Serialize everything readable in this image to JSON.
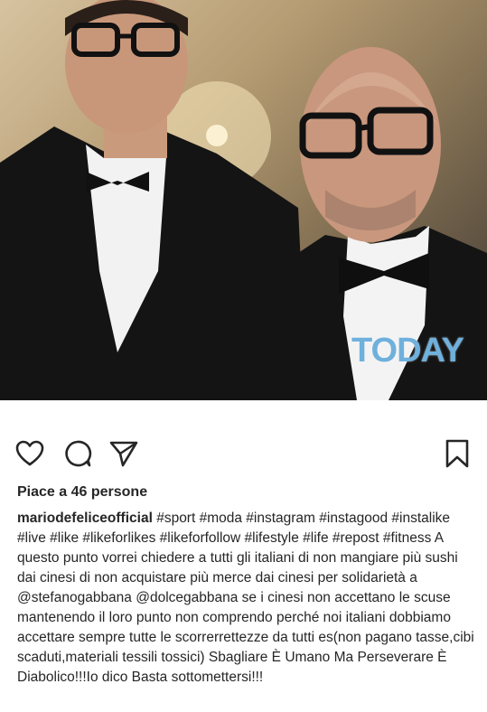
{
  "post": {
    "watermark": "TODAY",
    "likes_text": "Piace a 46 persone",
    "username": "mariodefeliceofficial",
    "caption": " #sport #moda #instagram #instagood #instalike #live #like #likeforlikes #likeforfollow #lifestyle #life #repost #fitness A questo punto vorrei chiedere a tutti gli italiani di non mangiare più sushi dai cinesi di non acquistare più merce dai cinesi per solidarietà a @stefanogabbana @dolcegabbana se i cinesi non accettano le scuse mantenendo il loro punto non comprendo perché noi italiani dobbiamo accettare sempre tutte le scorrerrettezze da tutti es(non pagano tasse,cibi scaduti,materiali tessili tossici) Sbagliare È Umano Ma Perseverare È Diabolico!!!Io dico Basta sottomettersi!!!"
  },
  "actions": {
    "like_icon": "heart-icon",
    "comment_icon": "comment-icon",
    "share_icon": "send-icon",
    "save_icon": "bookmark-icon"
  },
  "colors": {
    "text": "#262626",
    "watermark": "#6fb0dc"
  }
}
